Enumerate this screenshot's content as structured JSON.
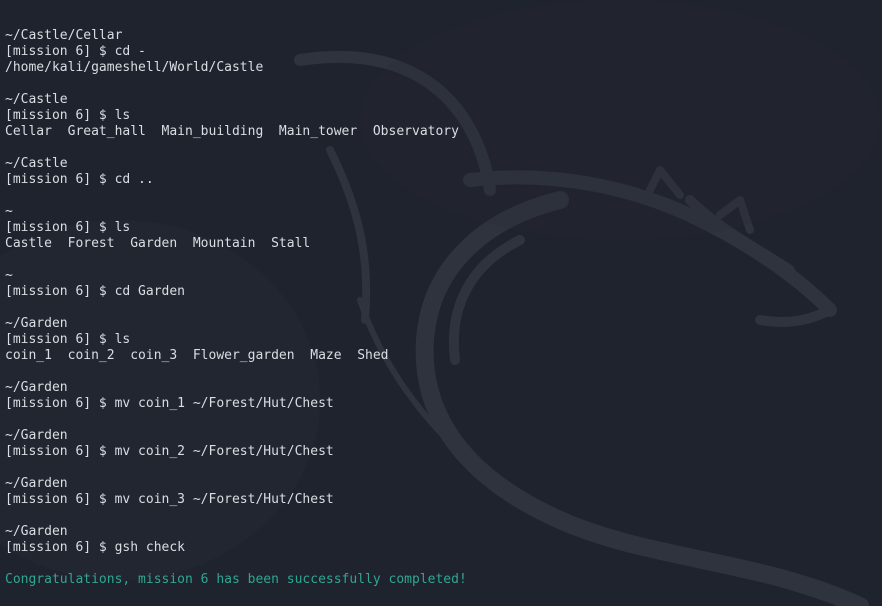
{
  "terminal": {
    "colors": {
      "background": "#1f232d",
      "text": "#dadde3",
      "success": "#2fa693"
    },
    "lines": [
      {
        "text": "~/Castle/Cellar",
        "kind": "path"
      },
      {
        "text": "[mission 6] $ cd -",
        "kind": "prompt"
      },
      {
        "text": "/home/kali/gameshell/World/Castle",
        "kind": "output"
      },
      {
        "text": "",
        "kind": "blank"
      },
      {
        "text": "~/Castle",
        "kind": "path"
      },
      {
        "text": "[mission 6] $ ls",
        "kind": "prompt"
      },
      {
        "text": "Cellar  Great_hall  Main_building  Main_tower  Observatory",
        "kind": "output"
      },
      {
        "text": "",
        "kind": "blank"
      },
      {
        "text": "~/Castle",
        "kind": "path"
      },
      {
        "text": "[mission 6] $ cd ..",
        "kind": "prompt"
      },
      {
        "text": "",
        "kind": "blank"
      },
      {
        "text": "~",
        "kind": "path"
      },
      {
        "text": "[mission 6] $ ls",
        "kind": "prompt"
      },
      {
        "text": "Castle  Forest  Garden  Mountain  Stall",
        "kind": "output"
      },
      {
        "text": "",
        "kind": "blank"
      },
      {
        "text": "~",
        "kind": "path"
      },
      {
        "text": "[mission 6] $ cd Garden",
        "kind": "prompt"
      },
      {
        "text": "",
        "kind": "blank"
      },
      {
        "text": "~/Garden",
        "kind": "path"
      },
      {
        "text": "[mission 6] $ ls",
        "kind": "prompt"
      },
      {
        "text": "coin_1  coin_2  coin_3  Flower_garden  Maze  Shed",
        "kind": "output"
      },
      {
        "text": "",
        "kind": "blank"
      },
      {
        "text": "~/Garden",
        "kind": "path"
      },
      {
        "text": "[mission 6] $ mv coin_1 ~/Forest/Hut/Chest",
        "kind": "prompt"
      },
      {
        "text": "",
        "kind": "blank"
      },
      {
        "text": "~/Garden",
        "kind": "path"
      },
      {
        "text": "[mission 6] $ mv coin_2 ~/Forest/Hut/Chest",
        "kind": "prompt"
      },
      {
        "text": "",
        "kind": "blank"
      },
      {
        "text": "~/Garden",
        "kind": "path"
      },
      {
        "text": "[mission 6] $ mv coin_3 ~/Forest/Hut/Chest",
        "kind": "prompt"
      },
      {
        "text": "",
        "kind": "blank"
      },
      {
        "text": "~/Garden",
        "kind": "path"
      },
      {
        "text": "[mission 6] $ gsh check",
        "kind": "prompt"
      },
      {
        "text": "",
        "kind": "blank"
      },
      {
        "text": "Congratulations, mission 6 has been successfully completed!",
        "kind": "success"
      }
    ]
  },
  "background": {
    "icon": "kali-dragon-logo-icon"
  }
}
